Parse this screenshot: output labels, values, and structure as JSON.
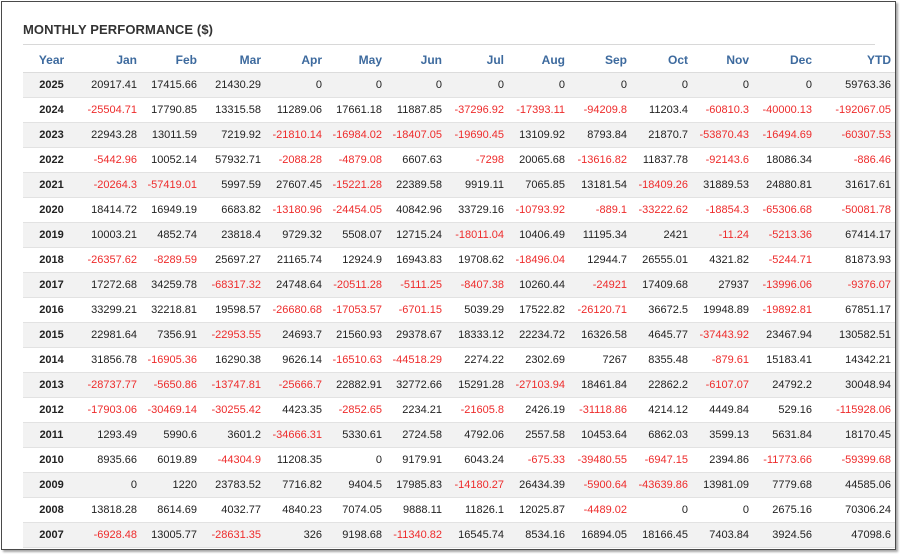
{
  "title": "MONTHLY PERFORMANCE ($)",
  "columns": [
    "Year",
    "Jan",
    "Feb",
    "Mar",
    "Apr",
    "May",
    "Jun",
    "Jul",
    "Aug",
    "Sep",
    "Oct",
    "Nov",
    "Dec",
    "YTD"
  ],
  "colors": {
    "header_text": "#3d6a9e",
    "negative": "#ee2b2b",
    "positive": "#222222",
    "stripe": "#f2f2f2"
  },
  "rows": [
    [
      "2025",
      "20917.41",
      "17415.66",
      "21430.29",
      "0",
      "0",
      "0",
      "0",
      "0",
      "0",
      "0",
      "0",
      "0",
      "59763.36"
    ],
    [
      "2024",
      "-25504.71",
      "17790.85",
      "13315.58",
      "11289.06",
      "17661.18",
      "11887.85",
      "-37296.92",
      "-17393.11",
      "-94209.8",
      "11203.4",
      "-60810.3",
      "-40000.13",
      "-192067.05"
    ],
    [
      "2023",
      "22943.28",
      "13011.59",
      "7219.92",
      "-21810.14",
      "-16984.02",
      "-18407.05",
      "-19690.45",
      "13109.92",
      "8793.84",
      "21870.7",
      "-53870.43",
      "-16494.69",
      "-60307.53"
    ],
    [
      "2022",
      "-5442.96",
      "10052.14",
      "57932.71",
      "-2088.28",
      "-4879.08",
      "6607.63",
      "-7298",
      "20065.68",
      "-13616.82",
      "11837.78",
      "-92143.6",
      "18086.34",
      "-886.46"
    ],
    [
      "2021",
      "-20264.3",
      "-57419.01",
      "5997.59",
      "27607.45",
      "-15221.28",
      "22389.58",
      "9919.11",
      "7065.85",
      "13181.54",
      "-18409.26",
      "31889.53",
      "24880.81",
      "31617.61"
    ],
    [
      "2020",
      "18414.72",
      "16949.19",
      "6683.82",
      "-13180.96",
      "-24454.05",
      "40842.96",
      "33729.16",
      "-10793.92",
      "-889.1",
      "-33222.62",
      "-18854.3",
      "-65306.68",
      "-50081.78"
    ],
    [
      "2019",
      "10003.21",
      "4852.74",
      "23818.4",
      "9729.32",
      "5508.07",
      "12715.24",
      "-18011.04",
      "10406.49",
      "11195.34",
      "2421",
      "-11.24",
      "-5213.36",
      "67414.17"
    ],
    [
      "2018",
      "-26357.62",
      "-8289.59",
      "25697.27",
      "21165.74",
      "12924.9",
      "16943.83",
      "19708.62",
      "-18496.04",
      "12944.7",
      "26555.01",
      "4321.82",
      "-5244.71",
      "81873.93"
    ],
    [
      "2017",
      "17272.68",
      "34259.78",
      "-68317.32",
      "24748.64",
      "-20511.28",
      "-5111.25",
      "-8407.38",
      "10260.44",
      "-24921",
      "17409.68",
      "27937",
      "-13996.06",
      "-9376.07"
    ],
    [
      "2016",
      "33299.21",
      "32218.81",
      "19598.57",
      "-26680.68",
      "-17053.57",
      "-6701.15",
      "5039.29",
      "17522.82",
      "-26120.71",
      "36672.5",
      "19948.89",
      "-19892.81",
      "67851.17"
    ],
    [
      "2015",
      "22981.64",
      "7356.91",
      "-22953.55",
      "24693.7",
      "21560.93",
      "29378.67",
      "18333.12",
      "22234.72",
      "16326.58",
      "4645.77",
      "-37443.92",
      "23467.94",
      "130582.51"
    ],
    [
      "2014",
      "31856.78",
      "-16905.36",
      "16290.38",
      "9626.14",
      "-16510.63",
      "-44518.29",
      "2274.22",
      "2302.69",
      "7267",
      "8355.48",
      "-879.61",
      "15183.41",
      "14342.21"
    ],
    [
      "2013",
      "-28737.77",
      "-5650.86",
      "-13747.81",
      "-25666.7",
      "22882.91",
      "32772.66",
      "15291.28",
      "-27103.94",
      "18461.84",
      "22862.2",
      "-6107.07",
      "24792.2",
      "30048.94"
    ],
    [
      "2012",
      "-17903.06",
      "-30469.14",
      "-30255.42",
      "4423.35",
      "-2852.65",
      "2234.21",
      "-21605.8",
      "2426.19",
      "-31118.86",
      "4214.12",
      "4449.84",
      "529.16",
      "-115928.06"
    ],
    [
      "2011",
      "1293.49",
      "5990.6",
      "3601.2",
      "-34666.31",
      "5330.61",
      "2724.58",
      "4792.06",
      "2557.58",
      "10453.64",
      "6862.03",
      "3599.13",
      "5631.84",
      "18170.45"
    ],
    [
      "2010",
      "8935.66",
      "6019.89",
      "-44304.9",
      "11208.35",
      "0",
      "9179.91",
      "6043.24",
      "-675.33",
      "-39480.55",
      "-6947.15",
      "2394.86",
      "-11773.66",
      "-59399.68"
    ],
    [
      "2009",
      "0",
      "1220",
      "23783.52",
      "7716.82",
      "9404.5",
      "17985.83",
      "-14180.27",
      "26434.39",
      "-5900.64",
      "-43639.86",
      "13981.09",
      "7779.68",
      "44585.06"
    ],
    [
      "2008",
      "13818.28",
      "8614.69",
      "4032.77",
      "4840.23",
      "7074.05",
      "9888.11",
      "11826.1",
      "12025.87",
      "-4489.02",
      "0",
      "0",
      "2675.16",
      "70306.24"
    ],
    [
      "2007",
      "-6928.48",
      "13005.77",
      "-28631.35",
      "326",
      "9198.68",
      "-11340.82",
      "16545.74",
      "8534.16",
      "16894.05",
      "18166.45",
      "7403.84",
      "3924.56",
      "47098.6"
    ]
  ]
}
